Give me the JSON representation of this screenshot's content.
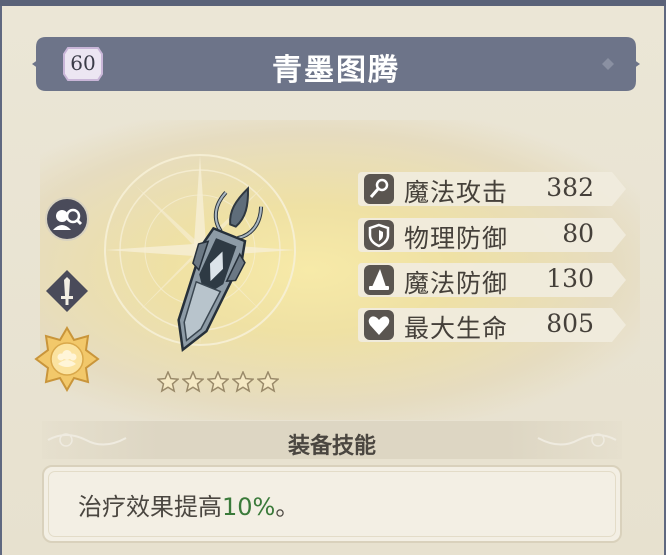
{
  "item": {
    "level": "60",
    "name": "青墨图腾",
    "rarity_stars": 5
  },
  "stats": [
    {
      "icon": "wand-icon",
      "label": "魔法攻击",
      "value": "382"
    },
    {
      "icon": "shield-icon",
      "label": "物理防御",
      "value": "80"
    },
    {
      "icon": "wizard-hat-icon",
      "label": "魔法防御",
      "value": "130"
    },
    {
      "icon": "heart-icon",
      "label": "最大生命",
      "value": "805"
    }
  ],
  "skill": {
    "header": "装备技能",
    "text_before": "治疗效果提高",
    "text_highlight": "10%",
    "text_after": "。"
  },
  "side_icons": [
    "inspect-icon",
    "sword-type-icon",
    "gold-flower-icon"
  ],
  "colors": {
    "banner": "#6d7489",
    "highlight": "#3a7a3a",
    "stat_bg": "#f0ebdd"
  }
}
